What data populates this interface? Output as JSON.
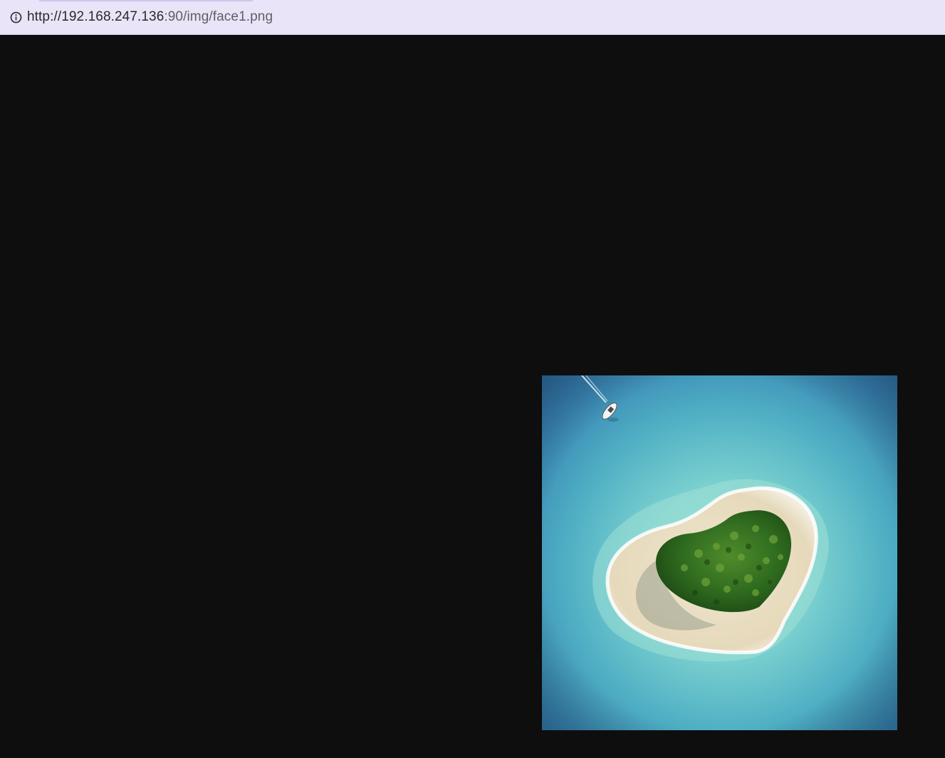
{
  "address_bar": {
    "url_host": "http://192.168.247.136",
    "url_rest": ":90/img/face1.png",
    "icon": "info-icon"
  },
  "viewer": {
    "image_icon": "heart-island-photo",
    "colors": {
      "page_background": "#0e0e0f",
      "deep_water": "#2f6fa3",
      "shallow_water": "#7fd3d0",
      "sand": "#e8dcc0",
      "foliage": "#2f6b1f"
    }
  }
}
